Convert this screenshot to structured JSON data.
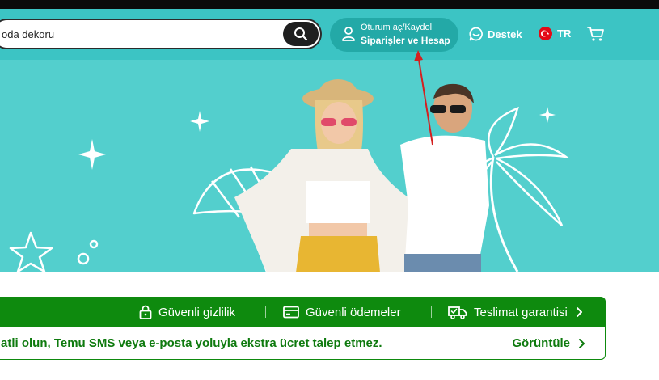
{
  "header": {
    "search_value": "oda dekoru",
    "account_line1": "Oturum aç/Kaydol",
    "account_line2": "Siparişler ve Hesap",
    "support_label": "Destek",
    "language_label": "TR"
  },
  "trust_bar": {
    "items": [
      {
        "label": "Güvenli gizlilik",
        "icon": "lock-icon"
      },
      {
        "label": "Güvenli ödemeler",
        "icon": "card-icon"
      },
      {
        "label": "Teslimat garantisi",
        "icon": "truck-icon"
      }
    ]
  },
  "notice": {
    "text": "atli olun, Temu SMS veya e-posta yoluyla ekstra ücret talep etmez.",
    "link_label": "Görüntüle"
  },
  "colors": {
    "header_bg": "#3cc4c4",
    "hero_bg": "#53cfcd",
    "trust_green": "#0e8a0e",
    "annotation_red": "#d42020"
  }
}
